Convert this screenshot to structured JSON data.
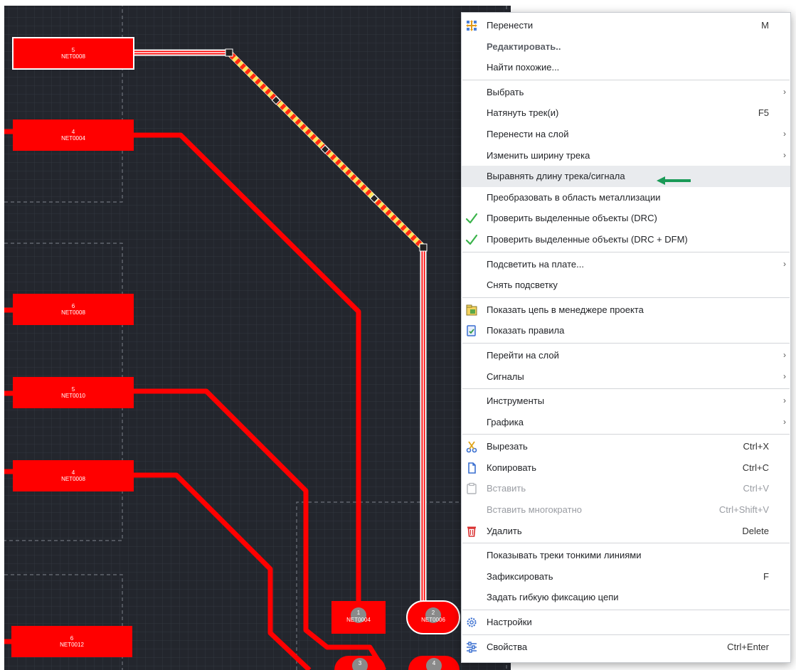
{
  "pcb": {
    "components": [
      {
        "pin": "5",
        "net": "NET0008"
      },
      {
        "pin": "4",
        "net": "NET0004"
      },
      {
        "pin": "6",
        "net": "NET0008"
      },
      {
        "pin": "5",
        "net": "NET0010"
      },
      {
        "pin": "4",
        "net": "NET0008"
      },
      {
        "pin": "6",
        "net": "NET0012"
      },
      {
        "pin": "1",
        "net": "NET0004"
      },
      {
        "pin": "2",
        "net": "NET0006"
      },
      {
        "pin": "3",
        "net": ""
      },
      {
        "pin": "4",
        "net": ""
      }
    ],
    "colors": {
      "background": "#23262d",
      "copper": "#ff0000",
      "selection": "#ffe45a"
    }
  },
  "menu": {
    "items": [
      {
        "label": "Перенести",
        "shortcut": "M",
        "icon": "move-icon"
      },
      {
        "label": "Редактировать..",
        "bold": true
      },
      {
        "label": "Найти похожие..."
      },
      {
        "separator": true
      },
      {
        "label": "Выбрать",
        "submenu": true
      },
      {
        "label": "Натянуть трек(и)",
        "shortcut": "F5"
      },
      {
        "label": "Перенести на слой",
        "submenu": true
      },
      {
        "label": "Изменить ширину трека",
        "submenu": true
      },
      {
        "label": "Выравнять длину трека/сигнала",
        "highlight": true
      },
      {
        "label": "Преобразовать в область металлизации"
      },
      {
        "label": "Проверить выделенные объекты (DRC)",
        "icon": "check-icon"
      },
      {
        "label": "Проверить выделенные объекты (DRC + DFM)",
        "icon": "check-icon"
      },
      {
        "separator": true
      },
      {
        "label": "Подсветить на плате...",
        "submenu": true
      },
      {
        "label": "Снять подсветку"
      },
      {
        "separator": true
      },
      {
        "label": "Показать цепь в менеджере проекта",
        "icon": "project-manager-icon"
      },
      {
        "label": "Показать правила",
        "icon": "rules-icon"
      },
      {
        "separator": true
      },
      {
        "label": "Перейти на слой",
        "submenu": true
      },
      {
        "label": "Сигналы",
        "submenu": true
      },
      {
        "separator": true
      },
      {
        "label": "Инструменты",
        "submenu": true
      },
      {
        "label": "Графика",
        "submenu": true
      },
      {
        "separator": true
      },
      {
        "label": "Вырезать",
        "shortcut": "Ctrl+X",
        "icon": "cut-icon"
      },
      {
        "label": "Копировать",
        "shortcut": "Ctrl+C",
        "icon": "copy-icon"
      },
      {
        "label": "Вставить",
        "shortcut": "Ctrl+V",
        "icon": "paste-icon",
        "disabled": true
      },
      {
        "label": "Вставить многократно",
        "shortcut": "Ctrl+Shift+V",
        "disabled": true
      },
      {
        "label": "Удалить",
        "shortcut": "Delete",
        "icon": "trash-icon"
      },
      {
        "separator": true
      },
      {
        "label": "Показывать треки тонкими линиями"
      },
      {
        "label": "Зафиксировать",
        "shortcut": "F"
      },
      {
        "label": "Задать гибкую фиксацию цепи"
      },
      {
        "separator": true
      },
      {
        "label": "Настройки",
        "icon": "gear-icon"
      },
      {
        "separator": true
      },
      {
        "label": "Свойства",
        "shortcut": "Ctrl+Enter",
        "icon": "properties-icon"
      }
    ],
    "arrow_glyph": "›",
    "annotation_arrow_color": "#1a9a57"
  }
}
